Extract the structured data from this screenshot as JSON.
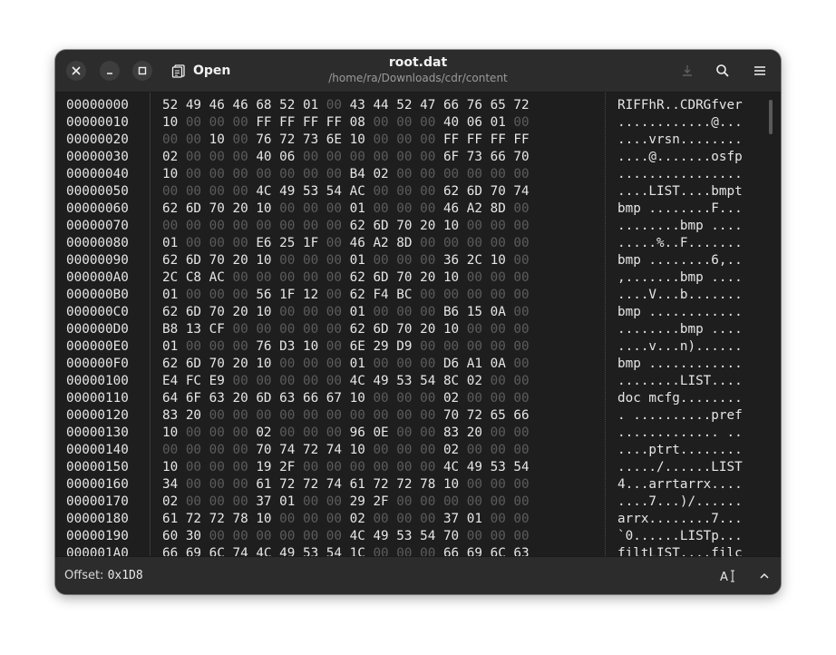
{
  "window": {
    "title": "root.dat",
    "path": "/home/ra/Downloads/cdr/content",
    "open_label": "Open"
  },
  "icons": {
    "close": "close-icon",
    "minimize": "minimize-icon",
    "maximize": "maximize-icon",
    "open": "open-file-icon",
    "save": "download-icon",
    "search": "search-icon",
    "menu": "hamburger-menu-icon",
    "insert_mode": "text-cursor-icon",
    "expand": "chevron-up-icon"
  },
  "hexview": {
    "rows": [
      {
        "addr": "00000000",
        "hex": "52 49 46 46 68 52 01 00 43 44 52 47 66 76 65 72",
        "ascii": "RIFFhR..CDRGfver"
      },
      {
        "addr": "00000010",
        "hex": "10 00 00 00 FF FF FF FF 08 00 00 00 40 06 01 00",
        "ascii": "............@..."
      },
      {
        "addr": "00000020",
        "hex": "00 00 10 00 76 72 73 6E 10 00 00 00 FF FF FF FF",
        "ascii": "....vrsn........"
      },
      {
        "addr": "00000030",
        "hex": "02 00 00 00 40 06 00 00 00 00 00 00 6F 73 66 70",
        "ascii": "....@.......osfp"
      },
      {
        "addr": "00000040",
        "hex": "10 00 00 00 00 00 00 00 B4 02 00 00 00 00 00 00",
        "ascii": "................"
      },
      {
        "addr": "00000050",
        "hex": "00 00 00 00 4C 49 53 54 AC 00 00 00 62 6D 70 74",
        "ascii": "....LIST....bmpt"
      },
      {
        "addr": "00000060",
        "hex": "62 6D 70 20 10 00 00 00 01 00 00 00 46 A2 8D 00",
        "ascii": "bmp ........F..."
      },
      {
        "addr": "00000070",
        "hex": "00 00 00 00 00 00 00 00 62 6D 70 20 10 00 00 00",
        "ascii": "........bmp ...."
      },
      {
        "addr": "00000080",
        "hex": "01 00 00 00 E6 25 1F 00 46 A2 8D 00 00 00 00 00",
        "ascii": ".....%..F......."
      },
      {
        "addr": "00000090",
        "hex": "62 6D 70 20 10 00 00 00 01 00 00 00 36 2C 10 00",
        "ascii": "bmp ........6,.."
      },
      {
        "addr": "000000A0",
        "hex": "2C C8 AC 00 00 00 00 00 62 6D 70 20 10 00 00 00",
        "ascii": ",.......bmp ...."
      },
      {
        "addr": "000000B0",
        "hex": "01 00 00 00 56 1F 12 00 62 F4 BC 00 00 00 00 00",
        "ascii": "....V...b......."
      },
      {
        "addr": "000000C0",
        "hex": "62 6D 70 20 10 00 00 00 01 00 00 00 B6 15 0A 00",
        "ascii": "bmp ............"
      },
      {
        "addr": "000000D0",
        "hex": "B8 13 CF 00 00 00 00 00 62 6D 70 20 10 00 00 00",
        "ascii": "........bmp ...."
      },
      {
        "addr": "000000E0",
        "hex": "01 00 00 00 76 D3 10 00 6E 29 D9 00 00 00 00 00",
        "ascii": "....v...n)......"
      },
      {
        "addr": "000000F0",
        "hex": "62 6D 70 20 10 00 00 00 01 00 00 00 D6 A1 0A 00",
        "ascii": "bmp ............"
      },
      {
        "addr": "00000100",
        "hex": "E4 FC E9 00 00 00 00 00 4C 49 53 54 8C 02 00 00",
        "ascii": "........LIST...."
      },
      {
        "addr": "00000110",
        "hex": "64 6F 63 20 6D 63 66 67 10 00 00 00 02 00 00 00",
        "ascii": "doc mcfg........"
      },
      {
        "addr": "00000120",
        "hex": "83 20 00 00 00 00 00 00 00 00 00 00 70 72 65 66",
        "ascii": ". ..........pref"
      },
      {
        "addr": "00000130",
        "hex": "10 00 00 00 02 00 00 00 96 0E 00 00 83 20 00 00",
        "ascii": "............. .."
      },
      {
        "addr": "00000140",
        "hex": "00 00 00 00 70 74 72 74 10 00 00 00 02 00 00 00",
        "ascii": "....ptrt........"
      },
      {
        "addr": "00000150",
        "hex": "10 00 00 00 19 2F 00 00 00 00 00 00 4C 49 53 54",
        "ascii": "...../......LIST"
      },
      {
        "addr": "00000160",
        "hex": "34 00 00 00 61 72 72 74 61 72 72 78 10 00 00 00",
        "ascii": "4...arrtarrx...."
      },
      {
        "addr": "00000170",
        "hex": "02 00 00 00 37 01 00 00 29 2F 00 00 00 00 00 00",
        "ascii": "....7...)/......"
      },
      {
        "addr": "00000180",
        "hex": "61 72 72 78 10 00 00 00 02 00 00 00 37 01 00 00",
        "ascii": "arrx........7..."
      },
      {
        "addr": "00000190",
        "hex": "60 30 00 00 00 00 00 00 4C 49 53 54 70 00 00 00",
        "ascii": "`0......LISTp..."
      },
      {
        "addr": "000001A0",
        "hex": "66 69 6C 74 4C 49 53 54 1C 00 00 00 66 69 6C 63",
        "ascii": "filtLIST....filc"
      }
    ]
  },
  "footer": {
    "offset_label": "Offset:",
    "offset_value": "0x1D8"
  },
  "colors": {
    "background": "#1e1e1e",
    "header": "#2c2c2c",
    "text": "#e6e6e6",
    "zero_byte": "#5c5c5c"
  }
}
